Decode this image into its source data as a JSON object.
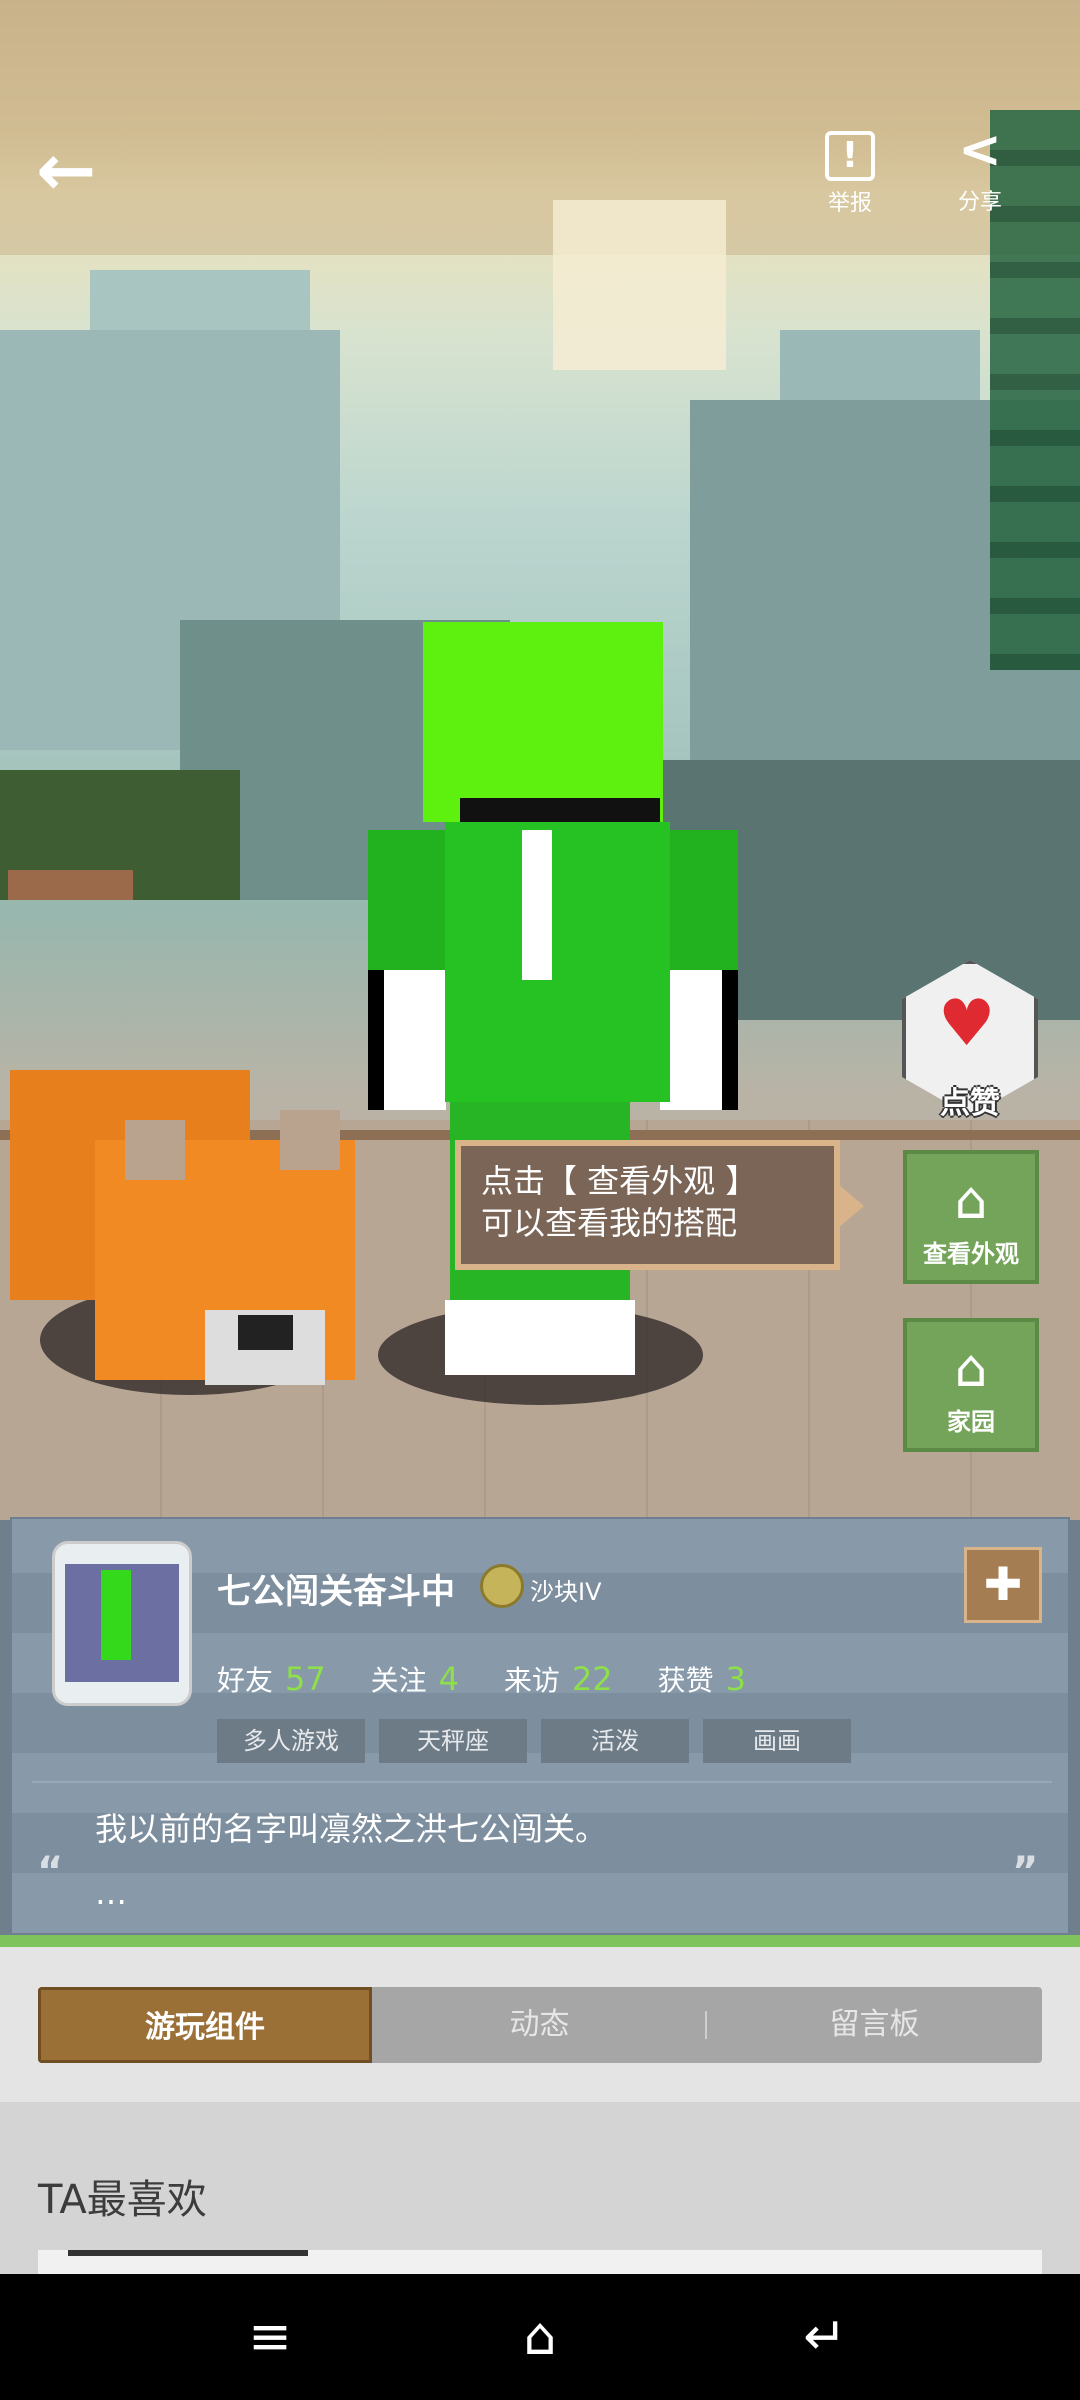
{
  "header": {
    "back_icon": "back-arrow-icon",
    "report_label": "举报",
    "share_label": "分享"
  },
  "scene": {
    "like_label": "点赞",
    "tooltip_line1": "点击【 查看外观 】",
    "tooltip_line2": "可以查看我的搭配",
    "view_outfit_label": "查看外观",
    "home_label": "家园"
  },
  "profile": {
    "name": "七公闯关奋斗中",
    "level": "沙块IV",
    "stats": [
      {
        "label": "好友",
        "value": "57"
      },
      {
        "label": "关注",
        "value": "4"
      },
      {
        "label": "来访",
        "value": "22"
      },
      {
        "label": "获赞",
        "value": "3"
      }
    ],
    "tags": [
      "多人游戏",
      "天秤座",
      "活泼",
      "画画"
    ],
    "bio": "我以前的名字叫凛然之洪七公闯关。",
    "bio_more": "…"
  },
  "tabs": [
    "游玩组件",
    "动态",
    "留言板"
  ],
  "active_tab": 0,
  "section_title": "TA最喜欢",
  "colors": {
    "accent_green": "#8ee04a",
    "tab_active": "#9b7037",
    "side_button": "#74a45a"
  }
}
